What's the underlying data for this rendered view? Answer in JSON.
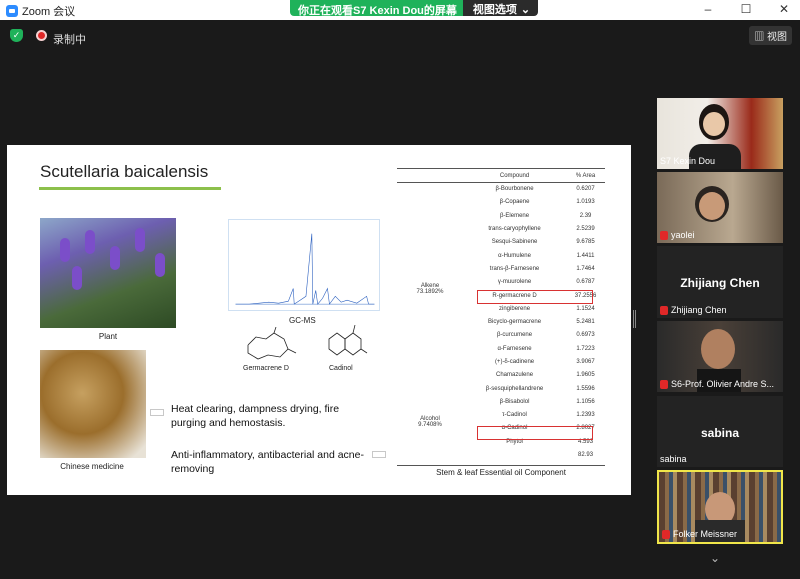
{
  "window": {
    "app_title": "Zoom 会议",
    "minimize": "–",
    "maximize": "☐",
    "close": "✕"
  },
  "banner": {
    "viewing": "你正在观看S7 Kexin Dou的屏幕",
    "view_options": "视图选项",
    "chevron": "⌄"
  },
  "status": {
    "recording": "录制中",
    "view_button": "视图"
  },
  "slide": {
    "title": "Scutellaria baicalensis",
    "plant_label": "Plant",
    "medicine_label": "Chinese medicine",
    "gcms_label": "GC-MS",
    "germacrene_label": "Germacrene D",
    "cadinol_label": "Cadinol",
    "effect_1": "Heat clearing, dampness drying, fire purging and hemostasis.",
    "effect_2": "Anti-inflammatory,  antibacterial and acne-removing",
    "table": {
      "headers": [
        "Compound",
        "% Area"
      ],
      "groups": [
        {
          "name": "Alkene\n73.1892%"
        },
        {
          "name": "Alcohol\n9.7408%"
        }
      ],
      "rows": [
        {
          "compound": "β-Bourbonene",
          "area": "0.6207"
        },
        {
          "compound": "β-Copaene",
          "area": "1.0193"
        },
        {
          "compound": "β-Elemene",
          "area": "2.39"
        },
        {
          "compound": "trans-caryophyllene",
          "area": "2.5239"
        },
        {
          "compound": "Sesqui-Sabinene",
          "area": "9.6785"
        },
        {
          "compound": "α-Humulene",
          "area": "1.4411"
        },
        {
          "compound": "trans-β-Farnesene",
          "area": "1.7464"
        },
        {
          "compound": "γ-muurolene",
          "area": "0.6787"
        },
        {
          "compound": "R-germacrene D",
          "area": "37.2556"
        },
        {
          "compound": "zingiberene",
          "area": "1.1524"
        },
        {
          "compound": "Bicyclo-germacrene",
          "area": "5.2481"
        },
        {
          "compound": "β-curcumene",
          "area": "0.6973"
        },
        {
          "compound": "α-Farnesene",
          "area": "1.7223"
        },
        {
          "compound": "(+)-δ-cadinene",
          "area": "3.9067"
        },
        {
          "compound": "Chamazulene",
          "area": "1.9605"
        },
        {
          "compound": "β-sesquiphellandrene",
          "area": "1.5596"
        },
        {
          "compound": "β-Bisabolol",
          "area": "1.1056"
        },
        {
          "compound": "τ-Cadinol",
          "area": "1.2393"
        },
        {
          "compound": "α-Cadinol",
          "area": "2.8027"
        },
        {
          "compound": "Phytol",
          "area": "4.593"
        },
        {
          "compound": "",
          "area": "82.93"
        }
      ],
      "caption": "Stem & leaf Essential oil Component"
    }
  },
  "participants": [
    {
      "name": "S7 Kexin Dou",
      "muted": false,
      "video": true
    },
    {
      "name": "yaolei",
      "muted": true,
      "video": true
    },
    {
      "name": "Zhijiang Chen",
      "muted": true,
      "video": false,
      "big": "Zhijiang Chen"
    },
    {
      "name": "S6-Prof. Olivier Andre S...",
      "muted": true,
      "video": true
    },
    {
      "name": "sabina",
      "muted": false,
      "video": false,
      "big": "sabina"
    },
    {
      "name": "Folker Meissner",
      "muted": true,
      "video": true,
      "active_speaker": true
    }
  ],
  "colors": {
    "accent_green": "#1fb25a",
    "title_underline": "#8cc04b",
    "highlight_red": "#d83232",
    "speaker_border": "#f0e64a"
  }
}
